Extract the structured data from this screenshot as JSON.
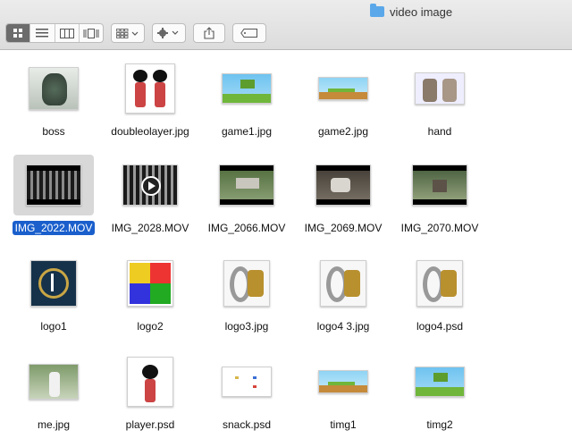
{
  "window": {
    "title": "video image"
  },
  "toolbar": {
    "view_icon": "icon-view-icon",
    "list_icon": "list-view-icon",
    "column_icon": "column-view-icon",
    "gallery_icon": "cover-flow-icon",
    "group_icon": "group-by-icon",
    "action_icon": "gear-icon",
    "share_icon": "share-icon",
    "tag_icon": "tag-icon"
  },
  "files": [
    {
      "name": "boss",
      "kind": "image"
    },
    {
      "name": "doubleolayer.jpg",
      "kind": "image"
    },
    {
      "name": "game1.jpg",
      "kind": "image"
    },
    {
      "name": "game2.jpg",
      "kind": "image"
    },
    {
      "name": "hand",
      "kind": "image"
    },
    {
      "name": "IMG_2022.MOV",
      "kind": "video",
      "selected": true
    },
    {
      "name": "IMG_2028.MOV",
      "kind": "video"
    },
    {
      "name": "IMG_2066.MOV",
      "kind": "video"
    },
    {
      "name": "IMG_2069.MOV",
      "kind": "video"
    },
    {
      "name": "IMG_2070.MOV",
      "kind": "video"
    },
    {
      "name": "logo1",
      "kind": "image"
    },
    {
      "name": "logo2",
      "kind": "image"
    },
    {
      "name": "logo3.jpg",
      "kind": "image"
    },
    {
      "name": "logo4 3.jpg",
      "kind": "image"
    },
    {
      "name": "logo4.psd",
      "kind": "image"
    },
    {
      "name": "me.jpg",
      "kind": "image"
    },
    {
      "name": "player.psd",
      "kind": "image"
    },
    {
      "name": "snack.psd",
      "kind": "image"
    },
    {
      "name": "timg1",
      "kind": "image"
    },
    {
      "name": "timg2",
      "kind": "image"
    }
  ],
  "colors": {
    "selection": "#1a5fcc",
    "folder": "#5aa8ea"
  }
}
